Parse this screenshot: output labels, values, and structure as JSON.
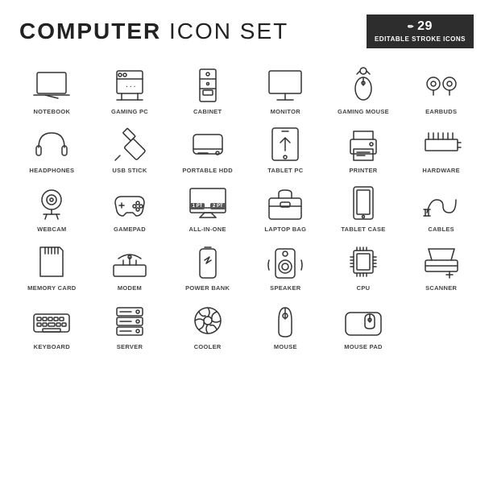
{
  "header": {
    "title_part1": "COMPUTER",
    "title_part2": "ICON SET",
    "badge_number": "29",
    "badge_line1": "EDITABLE STROKE ICONS",
    "badge_icon": "✏"
  },
  "icons": [
    {
      "id": "notebook",
      "label": "NOTEBOOK"
    },
    {
      "id": "gaming-pc",
      "label": "GAMING PC"
    },
    {
      "id": "cabinet",
      "label": "CABINET"
    },
    {
      "id": "monitor",
      "label": "MONITOR"
    },
    {
      "id": "gaming-mouse",
      "label": "GAMING MOUSE"
    },
    {
      "id": "earbuds",
      "label": "EARBUDS"
    },
    {
      "id": "headphones",
      "label": "HEADPHONES"
    },
    {
      "id": "usb-stick",
      "label": "USB STICK"
    },
    {
      "id": "portable-hdd",
      "label": "PORTABLE HDD"
    },
    {
      "id": "tablet-pc",
      "label": "TABLET PC"
    },
    {
      "id": "printer",
      "label": "PRINTER"
    },
    {
      "id": "hardware",
      "label": "HARDWARE"
    },
    {
      "id": "webcam",
      "label": "WEBCAM"
    },
    {
      "id": "gamepad",
      "label": "GAMEPAD"
    },
    {
      "id": "all-in-one",
      "label": "ALL-IN-ONE"
    },
    {
      "id": "laptop-bag",
      "label": "LAPTOP BAG"
    },
    {
      "id": "tablet-case",
      "label": "TABLET CASE"
    },
    {
      "id": "cables",
      "label": "CABLES"
    },
    {
      "id": "memory-card",
      "label": "MEMORY CARD"
    },
    {
      "id": "modem",
      "label": "MODEM"
    },
    {
      "id": "power-bank",
      "label": "POWER BANK"
    },
    {
      "id": "speaker",
      "label": "SPEAKER"
    },
    {
      "id": "cpu",
      "label": "CPU"
    },
    {
      "id": "scanner",
      "label": "SCANNER"
    },
    {
      "id": "keyboard",
      "label": "KEYBOARD"
    },
    {
      "id": "server",
      "label": "SERVER"
    },
    {
      "id": "cooler",
      "label": "COOLER"
    },
    {
      "id": "mouse",
      "label": "MOUSE"
    },
    {
      "id": "mouse-pad",
      "label": "MOUSE PAD"
    }
  ]
}
